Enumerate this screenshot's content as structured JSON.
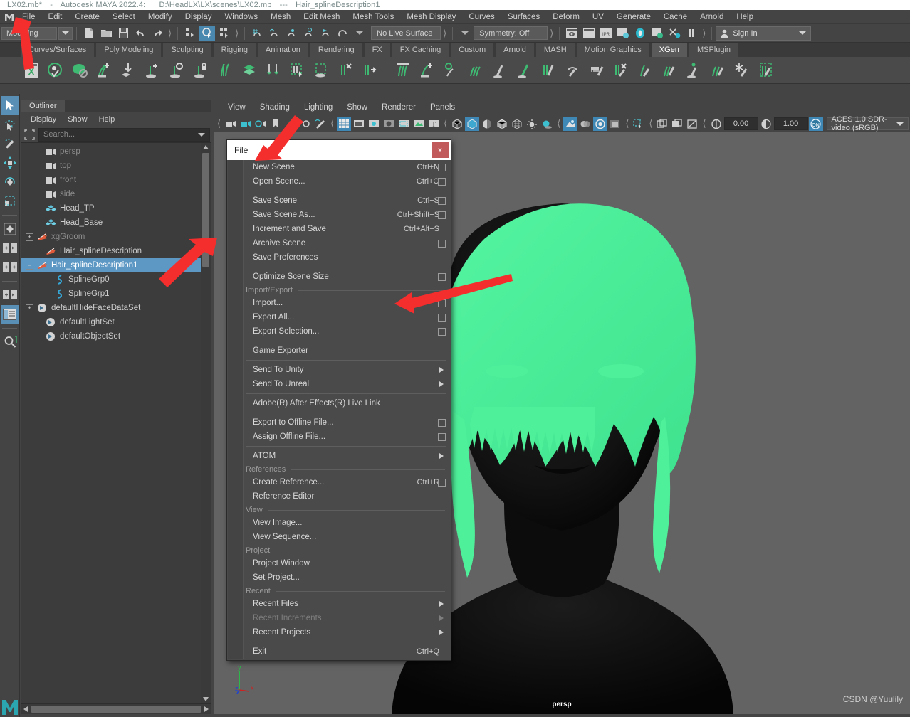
{
  "window": {
    "title_file": "LX02.mb*",
    "title_app": "Autodesk MAYA 2022.4:",
    "title_path": "D:\\HeadLX\\LX\\scenes\\LX02.mb",
    "title_sep": "---",
    "title_node": "Hair_splineDescription1"
  },
  "menubar": {
    "items": [
      "File",
      "Edit",
      "Create",
      "Select",
      "Modify",
      "Display",
      "Windows",
      "Mesh",
      "Edit Mesh",
      "Mesh Tools",
      "Mesh Display",
      "Curves",
      "Surfaces",
      "Deform",
      "UV",
      "Generate",
      "Cache",
      "Arnold",
      "Help"
    ]
  },
  "statusbar": {
    "menuset": "Modeling",
    "live_surface": "No Live Surface",
    "symmetry": "Symmetry: Off",
    "signin": "Sign In"
  },
  "shelf": {
    "tabs": [
      "Curves/Surfaces",
      "Poly Modeling",
      "Sculpting",
      "Rigging",
      "Animation",
      "Rendering",
      "FX",
      "FX Caching",
      "Custom",
      "Arnold",
      "MASH",
      "Motion Graphics",
      "XGen",
      "MSPlugin"
    ],
    "active_tab": "XGen",
    "icon_count": 28
  },
  "outliner": {
    "tab_label": "Outliner",
    "menu": [
      "Display",
      "Show",
      "Help"
    ],
    "search_placeholder": "Search...",
    "tree": [
      {
        "label": "persp",
        "icon": "camera-icon",
        "indent": 1,
        "expander": "none",
        "dim": true,
        "selected": false
      },
      {
        "label": "top",
        "icon": "camera-icon",
        "indent": 1,
        "expander": "none",
        "dim": true,
        "selected": false
      },
      {
        "label": "front",
        "icon": "camera-icon",
        "indent": 1,
        "expander": "none",
        "dim": true,
        "selected": false
      },
      {
        "label": "side",
        "icon": "camera-icon",
        "indent": 1,
        "expander": "none",
        "dim": true,
        "selected": false
      },
      {
        "label": "Head_TP",
        "icon": "mesh-icon",
        "indent": 1,
        "expander": "none",
        "dim": false,
        "selected": false
      },
      {
        "label": "Head_Base",
        "icon": "mesh-icon",
        "indent": 1,
        "expander": "none",
        "dim": false,
        "selected": false
      },
      {
        "label": "xgGroom",
        "icon": "xgen-icon",
        "indent": 0,
        "expander": "plus",
        "dim": true,
        "selected": false
      },
      {
        "label": "Hair_splineDescription",
        "icon": "xgen-icon",
        "indent": 1,
        "expander": "none",
        "dim": false,
        "selected": false
      },
      {
        "label": "Hair_splineDescription1",
        "icon": "xgen-icon",
        "indent": 0,
        "expander": "minus",
        "dim": false,
        "selected": true
      },
      {
        "label": "SplineGrp0",
        "icon": "spline-icon",
        "indent": 2,
        "expander": "none",
        "dim": false,
        "selected": false
      },
      {
        "label": "SplineGrp1",
        "icon": "spline-icon",
        "indent": 2,
        "expander": "none",
        "dim": false,
        "selected": false
      },
      {
        "label": "defaultHideFaceDataSet",
        "icon": "set-icon",
        "indent": 0,
        "expander": "plus",
        "dim": false,
        "selected": false
      },
      {
        "label": "defaultLightSet",
        "icon": "set-icon",
        "indent": 1,
        "expander": "none",
        "dim": false,
        "selected": false
      },
      {
        "label": "defaultObjectSet",
        "icon": "set-icon",
        "indent": 1,
        "expander": "none",
        "dim": false,
        "selected": false
      }
    ]
  },
  "viewport": {
    "menu": [
      "View",
      "Shading",
      "Lighting",
      "Show",
      "Renderer",
      "Panels"
    ],
    "exposure_value": "0.00",
    "gamma_value": "1.00",
    "color_space": "ACES 1.0 SDR-video (sRGB)",
    "camera_label": "persp",
    "watermark": "CSDN @Yuulily",
    "axis": {
      "x": "x",
      "y": "y",
      "z": "z"
    }
  },
  "file_menu": {
    "title": "File",
    "close_label": "x",
    "items": [
      {
        "kind": "item",
        "label": "New Scene",
        "accel": "Ctrl+N",
        "box": true,
        "sub": false,
        "disabled": false
      },
      {
        "kind": "item",
        "label": "Open Scene...",
        "accel": "Ctrl+O",
        "box": true,
        "sub": false,
        "disabled": false
      },
      {
        "kind": "sep"
      },
      {
        "kind": "item",
        "label": "Save Scene",
        "accel": "Ctrl+S",
        "box": true,
        "sub": false,
        "disabled": false
      },
      {
        "kind": "item",
        "label": "Save Scene As...",
        "accel": "Ctrl+Shift+S",
        "box": true,
        "sub": false,
        "disabled": false
      },
      {
        "kind": "item",
        "label": "Increment and Save",
        "accel": "Ctrl+Alt+S",
        "box": false,
        "sub": false,
        "disabled": false
      },
      {
        "kind": "item",
        "label": "Archive Scene",
        "accel": "",
        "box": true,
        "sub": false,
        "disabled": false
      },
      {
        "kind": "item",
        "label": "Save Preferences",
        "accel": "",
        "box": false,
        "sub": false,
        "disabled": false
      },
      {
        "kind": "sep"
      },
      {
        "kind": "item",
        "label": "Optimize Scene Size",
        "accel": "",
        "box": true,
        "sub": false,
        "disabled": false
      },
      {
        "kind": "group",
        "label": "Import/Export"
      },
      {
        "kind": "item",
        "label": "Import...",
        "accel": "",
        "box": true,
        "sub": false,
        "disabled": false
      },
      {
        "kind": "item",
        "label": "Export All...",
        "accel": "",
        "box": true,
        "sub": false,
        "disabled": false
      },
      {
        "kind": "item",
        "label": "Export Selection...",
        "accel": "",
        "box": true,
        "sub": false,
        "disabled": false
      },
      {
        "kind": "sep"
      },
      {
        "kind": "item",
        "label": "Game Exporter",
        "accel": "",
        "box": false,
        "sub": false,
        "disabled": false
      },
      {
        "kind": "sep"
      },
      {
        "kind": "item",
        "label": "Send To Unity",
        "accel": "",
        "box": false,
        "sub": true,
        "disabled": false
      },
      {
        "kind": "item",
        "label": "Send To Unreal",
        "accel": "",
        "box": false,
        "sub": true,
        "disabled": false
      },
      {
        "kind": "sep"
      },
      {
        "kind": "item",
        "label": "Adobe(R) After Effects(R) Live Link",
        "accel": "",
        "box": false,
        "sub": false,
        "disabled": false
      },
      {
        "kind": "sep"
      },
      {
        "kind": "item",
        "label": "Export to Offline File...",
        "accel": "",
        "box": true,
        "sub": false,
        "disabled": false
      },
      {
        "kind": "item",
        "label": "Assign Offline File...",
        "accel": "",
        "box": true,
        "sub": false,
        "disabled": false
      },
      {
        "kind": "sep"
      },
      {
        "kind": "item",
        "label": "ATOM",
        "accel": "",
        "box": false,
        "sub": true,
        "disabled": false
      },
      {
        "kind": "group",
        "label": "References"
      },
      {
        "kind": "item",
        "label": "Create Reference...",
        "accel": "Ctrl+R",
        "box": true,
        "sub": false,
        "disabled": false
      },
      {
        "kind": "item",
        "label": "Reference Editor",
        "accel": "",
        "box": false,
        "sub": false,
        "disabled": false
      },
      {
        "kind": "group",
        "label": "View"
      },
      {
        "kind": "item",
        "label": "View Image...",
        "accel": "",
        "box": false,
        "sub": false,
        "disabled": false
      },
      {
        "kind": "item",
        "label": "View Sequence...",
        "accel": "",
        "box": false,
        "sub": false,
        "disabled": false
      },
      {
        "kind": "group",
        "label": "Project"
      },
      {
        "kind": "item",
        "label": "Project Window",
        "accel": "",
        "box": false,
        "sub": false,
        "disabled": false
      },
      {
        "kind": "item",
        "label": "Set Project...",
        "accel": "",
        "box": false,
        "sub": false,
        "disabled": false
      },
      {
        "kind": "group",
        "label": "Recent"
      },
      {
        "kind": "item",
        "label": "Recent Files",
        "accel": "",
        "box": false,
        "sub": true,
        "disabled": false
      },
      {
        "kind": "item",
        "label": "Recent Increments",
        "accel": "",
        "box": false,
        "sub": true,
        "disabled": true
      },
      {
        "kind": "item",
        "label": "Recent Projects",
        "accel": "",
        "box": false,
        "sub": true,
        "disabled": false
      },
      {
        "kind": "sep"
      },
      {
        "kind": "item",
        "label": "Exit",
        "accel": "Ctrl+Q",
        "box": false,
        "sub": false,
        "disabled": false
      }
    ]
  },
  "colors": {
    "accent_blue": "#5d97c4",
    "hair_green": "#4ff09a",
    "annotation_red": "#f42d2d",
    "panel_bg": "#444444",
    "viewport_bg": "#636363",
    "close_red": "#c15a5a"
  }
}
